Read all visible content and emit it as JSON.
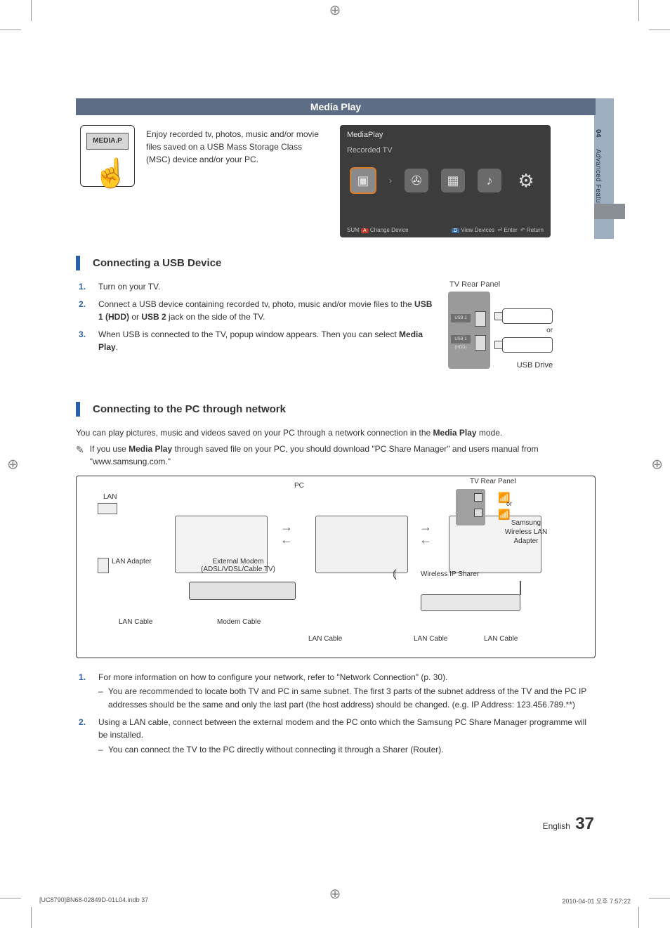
{
  "sideTab": {
    "chapter": "04",
    "title": "Advanced Features"
  },
  "header": {
    "title": "Media Play"
  },
  "remote": {
    "button": "MEDIA.P"
  },
  "intro": "Enjoy recorded tv, photos, music and/or movie files saved on a USB Mass Storage Class (MSC) device and/or your PC.",
  "mediaPlayScreen": {
    "title": "MediaPlay",
    "subtitle": "Recorded TV",
    "bottomLeft_sum": "SUM",
    "bottomLeft_a": "A",
    "bottomLeft_change": "Change Device",
    "bottomRight_d": "D",
    "bottomRight_view": "View Devices",
    "bottomRight_enter": "Enter",
    "bottomRight_return": "Return"
  },
  "section1": {
    "heading": "Connecting a USB Device",
    "steps": {
      "s1": "Turn on your TV.",
      "s2_a": "Connect a USB device containing recorded tv, photo, music and/or movie files to the ",
      "s2_b1": "USB 1 (HDD)",
      "s2_or": " or ",
      "s2_b2": "USB 2",
      "s2_c": " jack on the side of the TV.",
      "s3_a": "When USB is connected to the TV, popup window appears. Then you can select ",
      "s3_b": "Media Play",
      "s3_c": "."
    },
    "diagram": {
      "tvRear": "TV Rear Panel",
      "port1": "USB 2",
      "port2": "USB 1 (HDD)",
      "or": "or",
      "usbDrive": "USB Drive"
    }
  },
  "section2": {
    "heading": "Connecting to the PC through network",
    "intro_a": "You can play pictures, music and videos saved on your PC through a network connection in the ",
    "intro_b": "Media Play",
    "intro_c": " mode.",
    "note_a": "If you use ",
    "note_b": "Media Play",
    "note_c": " through saved file on your PC, you should download \"PC Share Manager\" and users manual from \"www.samsung.com.\"",
    "diagram": {
      "pc": "PC",
      "tvRear": "TV Rear Panel",
      "lan": "LAN",
      "lanAdapter": "LAN Adapter",
      "externalModem": "External Modem\n(ADSL/VDSL/Cable TV)",
      "lanCable": "LAN Cable",
      "modemCable": "Modem Cable",
      "wirelessSharer": "Wireless IP Sharer",
      "samsungWireless": "Samsung Wireless LAN Adapter",
      "or": "or"
    },
    "steps": {
      "s1": "For more information on how to configure your network, refer to \"Network Connection\" (p. 30).",
      "s1_sub": "You are recommended to locate both TV and PC in same subnet. The first 3 parts of the subnet address of the TV and the PC IP addresses should be the same and only the last part (the host address) should be changed. (e.g. IP Address: 123.456.789.**)",
      "s2": "Using a LAN cable, connect between the external modem and the PC onto which the Samsung PC Share Manager programme will be installed.",
      "s2_sub": "You can connect the TV to the PC directly without connecting it through a Sharer (Router)."
    }
  },
  "footer": {
    "lang": "English",
    "page": "37"
  },
  "printFooter": {
    "left": "[UC8790]BN68-02849D-01L04.indb   37",
    "right": "2010-04-01   오후 7:57:22"
  }
}
